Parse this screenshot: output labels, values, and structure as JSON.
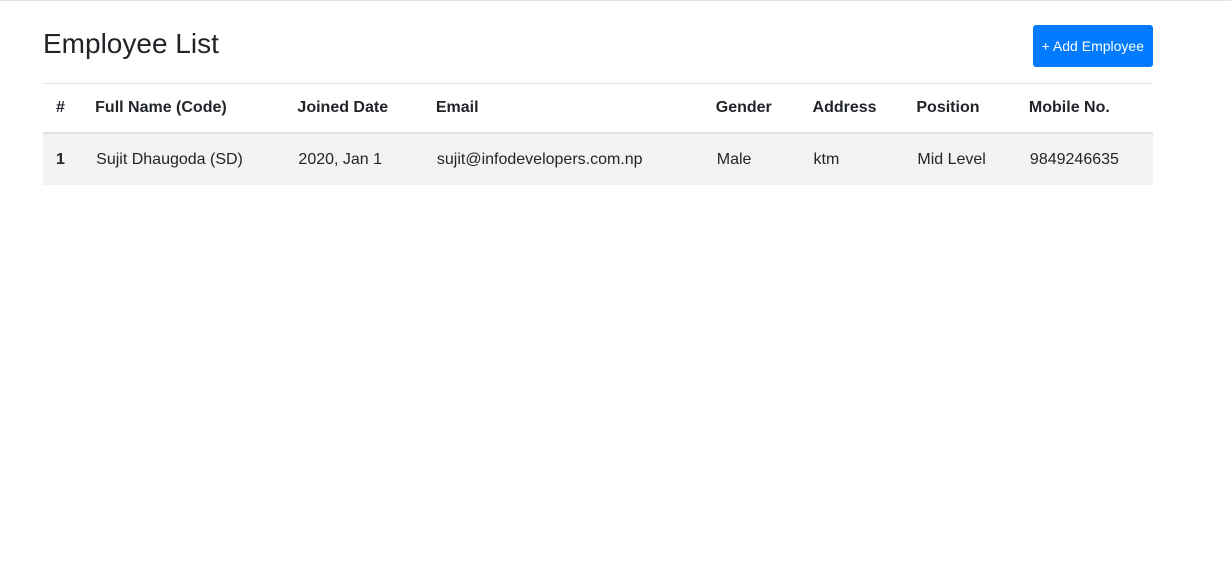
{
  "page": {
    "title": "Employee List",
    "add_button_label": "+ Add Employee"
  },
  "table": {
    "columns": [
      "#",
      "Full Name (Code)",
      "Joined Date",
      "Email",
      "Gender",
      "Address",
      "Position",
      "Mobile No."
    ],
    "rows": [
      {
        "index": "1",
        "full_name": "Sujit Dhaugoda (SD)",
        "joined_date": "2020, Jan 1",
        "email": "sujit@infodevelopers.com.np",
        "gender": "Male",
        "address": "ktm",
        "position": "Mid Level",
        "mobile": "9849246635"
      }
    ]
  },
  "colors": {
    "primary": "#007bff",
    "text": "#212529",
    "border": "#dee2e6",
    "stripe": "#f2f2f2"
  }
}
